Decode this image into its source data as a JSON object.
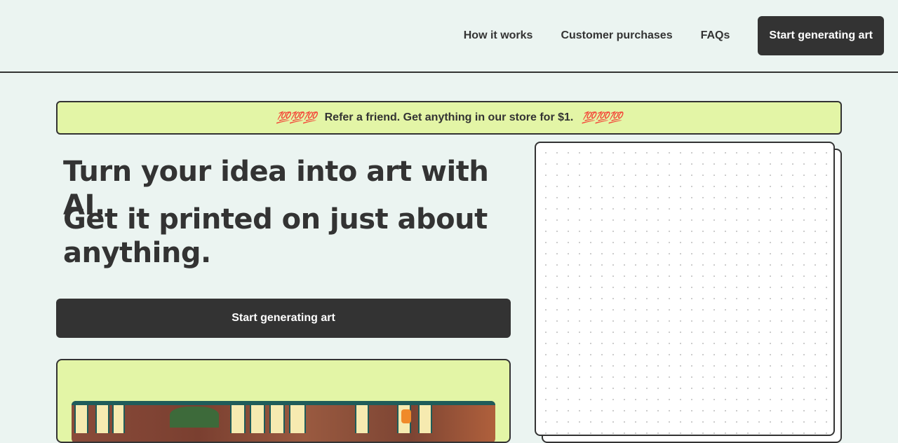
{
  "header": {
    "nav": [
      {
        "label": "How it works"
      },
      {
        "label": "Customer purchases"
      },
      {
        "label": "FAQs"
      }
    ],
    "cta_label": "Start generating art"
  },
  "promo": {
    "emoji_left": "💯💯💯",
    "text": "Refer a friend. Get anything in our store for $1.",
    "emoji_right": "💯💯💯"
  },
  "hero": {
    "headline_1": "Turn your idea into art with AI.",
    "headline_2": "Get it printed on just about anything.",
    "cta_label": "Start generating art"
  },
  "colors": {
    "background": "#ebf4f1",
    "dark": "#333333",
    "accent": "#e3f5a6"
  }
}
